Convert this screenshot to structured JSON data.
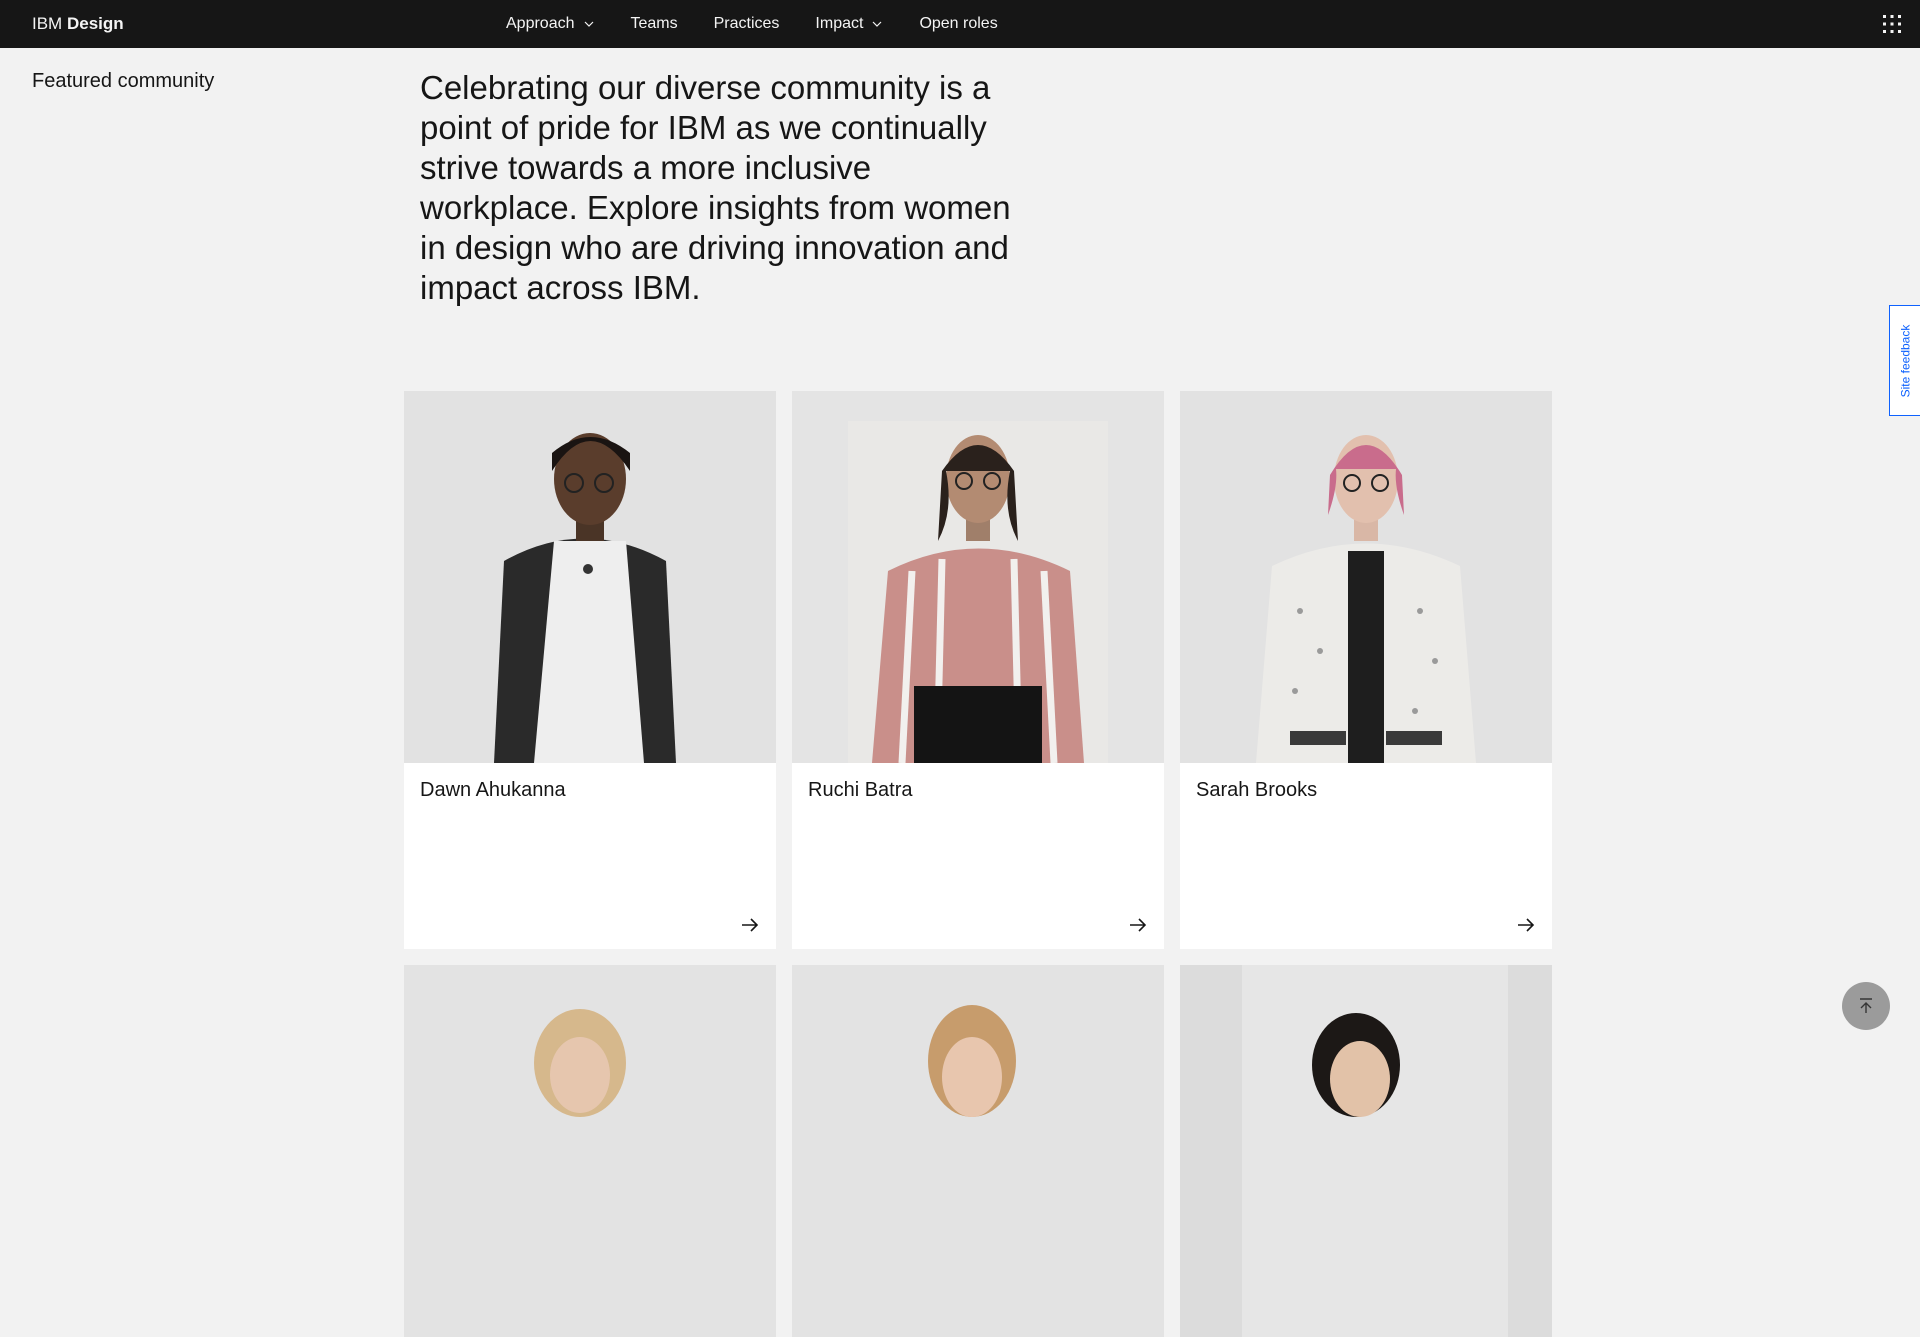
{
  "header": {
    "brand_prefix": "IBM",
    "brand_name": "Design",
    "nav": [
      {
        "label": "Approach",
        "has_dropdown": true
      },
      {
        "label": "Teams",
        "has_dropdown": false
      },
      {
        "label": "Practices",
        "has_dropdown": false
      },
      {
        "label": "Impact",
        "has_dropdown": true
      },
      {
        "label": "Open roles",
        "has_dropdown": false
      }
    ],
    "switcher_icon": "app-switcher-grid-icon"
  },
  "section": {
    "label": "Featured community",
    "intro": "Celebrating our diverse community is a point of pride for IBM as we continually strive towards a more inclusive workplace. Explore insights from women in design who are driving innovation and impact across IBM."
  },
  "feedback": {
    "label": "Site feedback"
  },
  "cards": [
    {
      "name": "Dawn Ahukanna",
      "icon": "arrow-right-icon"
    },
    {
      "name": "Ruchi Batra",
      "icon": "arrow-right-icon"
    },
    {
      "name": "Sarah Brooks",
      "icon": "arrow-right-icon"
    },
    {
      "name": ""
    },
    {
      "name": ""
    },
    {
      "name": ""
    }
  ],
  "colors": {
    "nav_bg": "#161616",
    "page_bg": "#f2f2f2",
    "accent": "#0f62fe",
    "card_bg": "#ffffff",
    "photo_bg": "#e0e0e0"
  }
}
